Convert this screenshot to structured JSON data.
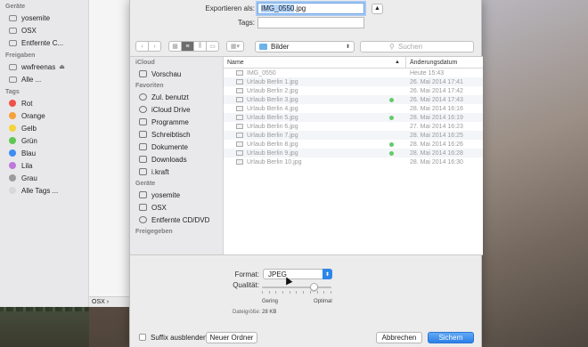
{
  "bg_finder": {
    "sections": [
      {
        "title": "Geräte",
        "items": [
          {
            "label": "yosemite",
            "icon": "disk-icon"
          },
          {
            "label": "OSX",
            "icon": "disk-icon"
          },
          {
            "label": "Entfernte C...",
            "icon": "disc-icon"
          }
        ]
      },
      {
        "title": "Freigaben",
        "items": [
          {
            "label": "wwfreenas",
            "icon": "display-icon"
          },
          {
            "label": "Alle ...",
            "icon": "globe-icon"
          }
        ]
      },
      {
        "title": "Tags",
        "items": [
          {
            "label": "Rot",
            "color": "#f0504a"
          },
          {
            "label": "Orange",
            "color": "#f5a03a"
          },
          {
            "label": "Gelb",
            "color": "#f3d43b"
          },
          {
            "label": "Grün",
            "color": "#5fc752"
          },
          {
            "label": "Blau",
            "color": "#3f8df3"
          },
          {
            "label": "Lila",
            "color": "#bf77db"
          },
          {
            "label": "Grau",
            "color": "#9c9c9c"
          },
          {
            "label": "Alle Tags ...",
            "color": "#d8d8d8"
          }
        ]
      }
    ],
    "status": "OSX ›"
  },
  "sheet": {
    "export_label": "Exportieren als:",
    "filename_value": "IMG_0550",
    "filename_ext": ".jpg",
    "tags_label": "Tags:",
    "tags_value": "",
    "expand_glyph": "▲"
  },
  "toolbar": {
    "back": "‹",
    "forward": "›",
    "location": "Bilder",
    "search_placeholder": "Suchen"
  },
  "sidebar": {
    "sections": [
      {
        "title": "iCloud",
        "items": [
          {
            "label": "Vorschau",
            "icon": "preview-app-icon"
          }
        ]
      },
      {
        "title": "Favoriten",
        "items": [
          {
            "label": "Zul. benutzt",
            "icon": "recents-icon"
          },
          {
            "label": "iCloud Drive",
            "icon": "cloud-icon"
          },
          {
            "label": "Programme",
            "icon": "applications-icon"
          },
          {
            "label": "Schreibtisch",
            "icon": "desktop-icon"
          },
          {
            "label": "Dokumente",
            "icon": "documents-icon"
          },
          {
            "label": "Downloads",
            "icon": "downloads-icon"
          },
          {
            "label": "i.kraft",
            "icon": "home-icon"
          }
        ]
      },
      {
        "title": "Geräte",
        "items": [
          {
            "label": "yosemite",
            "icon": "disk-icon"
          },
          {
            "label": "OSX",
            "icon": "disk-icon"
          },
          {
            "label": "Entfernte CD/DVD",
            "icon": "disc-icon"
          }
        ]
      },
      {
        "title": "Freigegeben",
        "items": []
      }
    ]
  },
  "list": {
    "col_name": "Name",
    "col_date": "Änderungsdatum",
    "sort_glyph": "▲",
    "rows": [
      {
        "name": "IMG_0550",
        "date": "Heute 15:43",
        "tag": false
      },
      {
        "name": "Urlaub Berlin 1.jpg",
        "date": "26. Mai 2014 17:41",
        "tag": false
      },
      {
        "name": "Urlaub Berlin 2.jpg",
        "date": "26. Mai 2014 17:42",
        "tag": false
      },
      {
        "name": "Urlaub Berlin 3.jpg",
        "date": "26. Mai 2014 17:43",
        "tag": true
      },
      {
        "name": "Urlaub Berlin 4.jpg",
        "date": "28. Mai 2014 16:16",
        "tag": false
      },
      {
        "name": "Urlaub Berlin 5.jpg",
        "date": "28. Mai 2014 16:19",
        "tag": true
      },
      {
        "name": "Urlaub Berlin 6.jpg",
        "date": "27. Mai 2014 16:23",
        "tag": false
      },
      {
        "name": "Urlaub Berlin 7.jpg",
        "date": "28. Mai 2014 16:25",
        "tag": false
      },
      {
        "name": "Urlaub Berlin 8.jpg",
        "date": "28. Mai 2014 16:26",
        "tag": true
      },
      {
        "name": "Urlaub Berlin 9.jpg",
        "date": "28. Mai 2014 16:28",
        "tag": true
      },
      {
        "name": "Urlaub Berlin 10.jpg",
        "date": "28. Mai 2014 16:30",
        "tag": false
      }
    ]
  },
  "options": {
    "format_label": "Format:",
    "format_value": "JPEG",
    "quality_label": "Qualität:",
    "quality_min": "Gering",
    "quality_max": "Optimal",
    "quality_level": 0.75,
    "filesize_label": "Dateigröße:",
    "filesize_value": "28 KB"
  },
  "bottom": {
    "suffix_label": "Suffix ausblenden",
    "new_folder": "Neuer Ordner",
    "cancel": "Abbrechen",
    "save": "Sichern"
  }
}
